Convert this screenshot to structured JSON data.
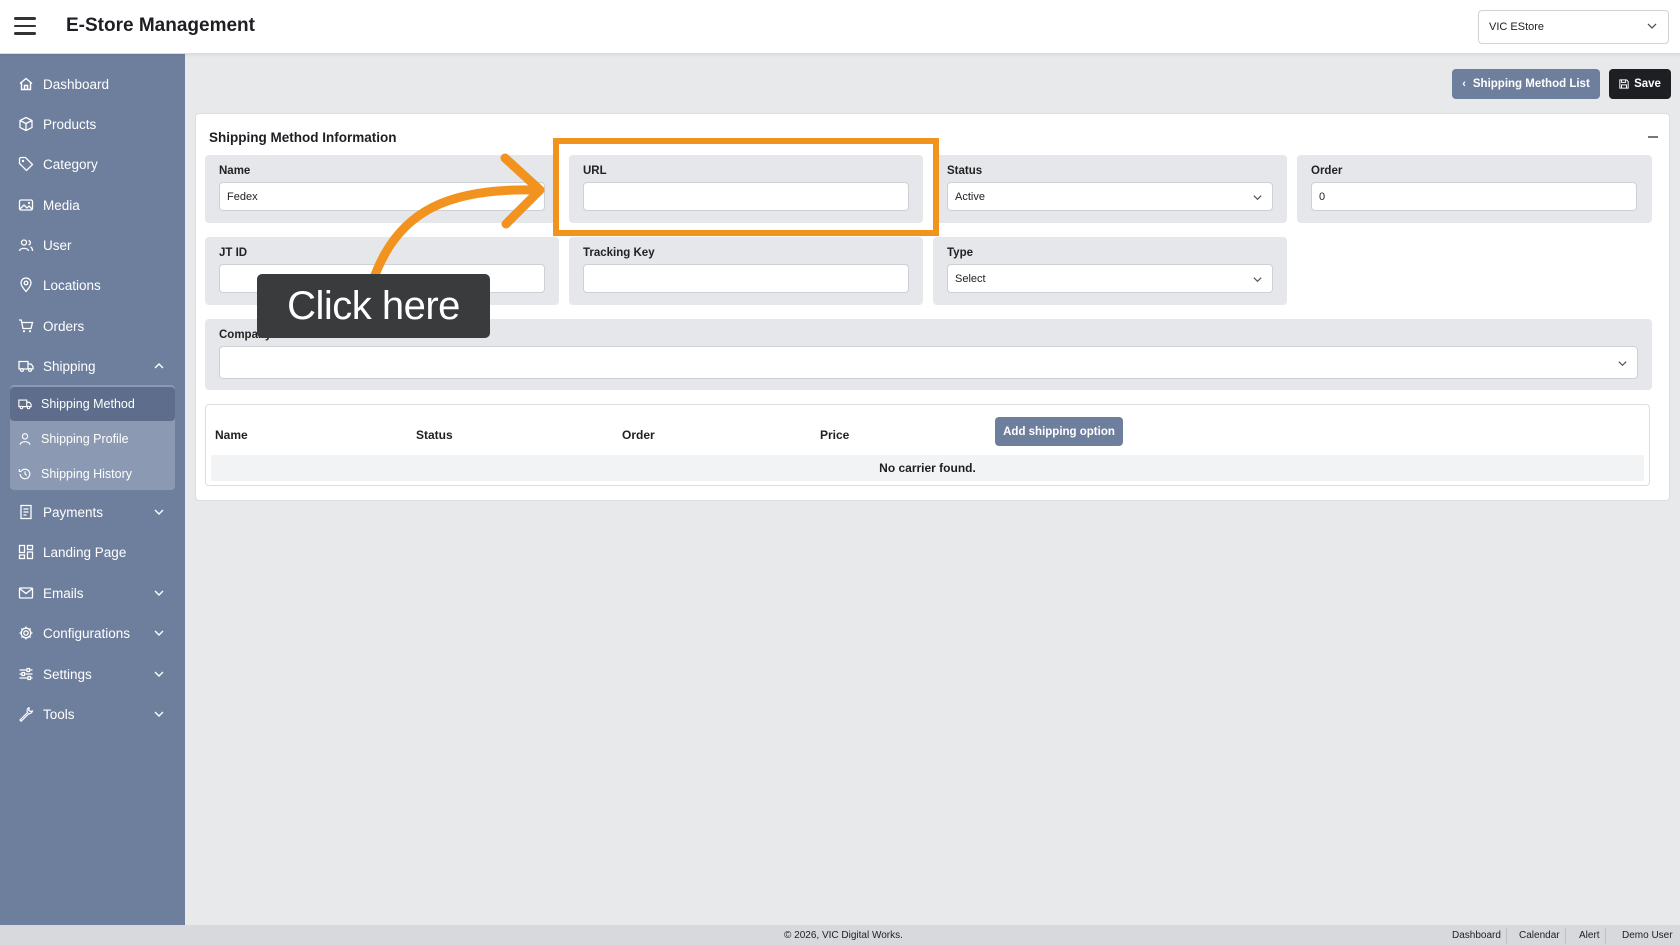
{
  "header": {
    "title": "E-Store Management",
    "store_selected": "VIC EStore"
  },
  "sidebar": {
    "items": [
      {
        "label": "Dashboard",
        "icon": "home-icon"
      },
      {
        "label": "Products",
        "icon": "box-icon"
      },
      {
        "label": "Category",
        "icon": "tag-icon"
      },
      {
        "label": "Media",
        "icon": "image-icon"
      },
      {
        "label": "User",
        "icon": "users-icon"
      },
      {
        "label": "Locations",
        "icon": "map-pin-icon"
      },
      {
        "label": "Orders",
        "icon": "cart-icon"
      },
      {
        "label": "Shipping",
        "icon": "truck-icon"
      },
      {
        "label": "Payments",
        "icon": "receipt-icon"
      },
      {
        "label": "Landing Page",
        "icon": "layout-icon"
      },
      {
        "label": "Emails",
        "icon": "mail-icon"
      },
      {
        "label": "Configurations",
        "icon": "gear-icon"
      },
      {
        "label": "Settings",
        "icon": "sliders-icon"
      },
      {
        "label": "Tools",
        "icon": "wrench-icon"
      }
    ],
    "shipping_sub": [
      {
        "label": "Shipping Method",
        "icon": "truck-icon",
        "active": true
      },
      {
        "label": "Shipping Profile",
        "icon": "user-icon"
      },
      {
        "label": "Shipping History",
        "icon": "history-icon"
      }
    ]
  },
  "actions": {
    "list_label": "Shipping Method List",
    "save_label": "Save"
  },
  "card": {
    "title": "Shipping Method Information",
    "fields": {
      "name": {
        "label": "Name",
        "value": "Fedex"
      },
      "url": {
        "label": "URL",
        "value": ""
      },
      "status": {
        "label": "Status",
        "value": "Active"
      },
      "order": {
        "label": "Order",
        "value": "0"
      },
      "jt_id": {
        "label": "JT ID",
        "value": ""
      },
      "tracking_key": {
        "label": "Tracking Key",
        "value": ""
      },
      "type": {
        "label": "Type",
        "value": "Select"
      },
      "company": {
        "label": "Company",
        "value": ""
      }
    },
    "table": {
      "columns": [
        "Name",
        "Status",
        "Order",
        "Price"
      ],
      "add_label": "Add shipping option",
      "empty_text": "No carrier found."
    }
  },
  "overlay": {
    "callout": "Click here",
    "accent": "#f3931f"
  },
  "footer": {
    "copyright": "© 2026, VIC Digital Works.",
    "links": [
      "Dashboard",
      "Calendar",
      "Alert",
      "Demo User"
    ]
  },
  "colors": {
    "sidebar": "#6e7f9d",
    "submenu": "#8b99b2",
    "active_item": "#5d6d8b",
    "dark_button": "#1d1f22"
  }
}
